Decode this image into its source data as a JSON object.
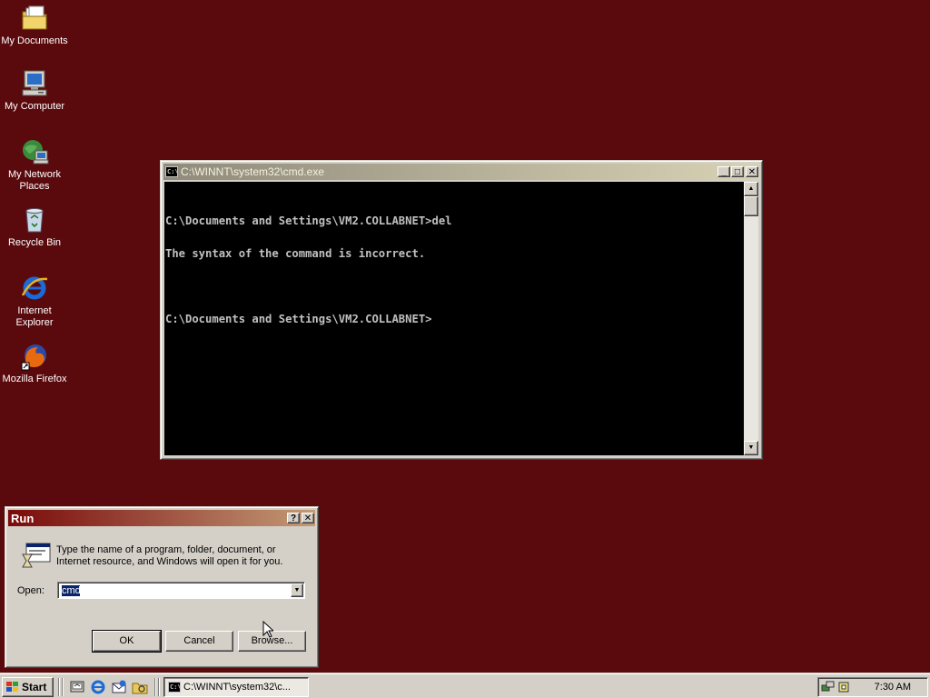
{
  "desktop": {
    "background_color": "#5a0a0d",
    "icons": [
      {
        "label": "My Documents",
        "icon": "folder-documents-icon"
      },
      {
        "label": "My Computer",
        "icon": "computer-icon"
      },
      {
        "label_line1": "My Network",
        "label_line2": "Places",
        "icon": "network-places-icon"
      },
      {
        "label": "Recycle Bin",
        "icon": "recycle-bin-icon"
      },
      {
        "label_line1": "Internet",
        "label_line2": "Explorer",
        "icon": "internet-explorer-icon"
      },
      {
        "label": "Mozilla Firefox",
        "icon": "firefox-icon"
      }
    ]
  },
  "cmd_window": {
    "title": "C:\\WINNT\\system32\\cmd.exe",
    "icon_text": "C:\\",
    "lines": [
      "C:\\Documents and Settings\\VM2.COLLABNET>del",
      "The syntax of the command is incorrect.",
      "",
      "C:\\Documents and Settings\\VM2.COLLABNET>"
    ],
    "buttons": {
      "minimize": "_",
      "maximize": "□",
      "close": "✕"
    }
  },
  "run_dialog": {
    "title": "Run",
    "help_button": "?",
    "close_button": "✕",
    "instructions_line1": "Type the name of a program, folder, document, or",
    "instructions_line2": "Internet resource, and Windows will open it for you.",
    "open_label": "Open:",
    "open_value": "cmd",
    "ok_label": "OK",
    "cancel_label": "Cancel",
    "browse_label": "Browse..."
  },
  "taskbar": {
    "start_label": "Start",
    "task_button_label": "C:\\WINNT\\system32\\c...",
    "clock": "7:30 AM"
  }
}
